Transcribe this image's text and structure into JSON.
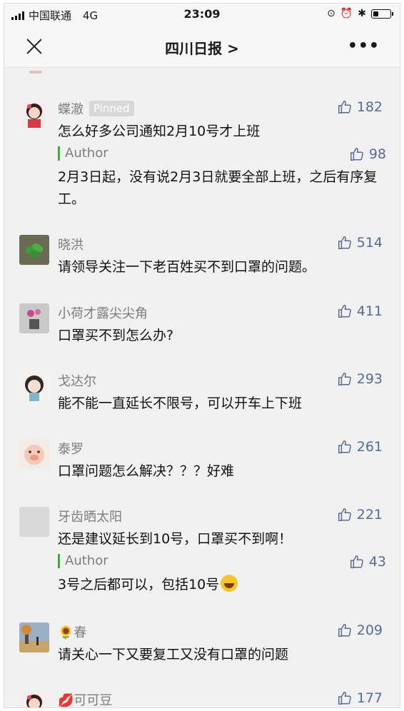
{
  "status_bar": {
    "carrier": "中国联通",
    "network": "4G",
    "time": "23:09",
    "battery_level": 0.3
  },
  "nav": {
    "title": "四川日报 >",
    "more": "•••"
  },
  "comments": [
    {
      "name": "蝶澈",
      "badge": "Pinned",
      "likes": "182",
      "text": "怎么好多公司通知2月10号才上班",
      "reply": {
        "author_label": "Author",
        "likes": "98",
        "text": "2月3日起，没有说2月3日就要全部上班，之后有序复工。"
      }
    },
    {
      "name": "晓洪",
      "likes": "514",
      "text": "请领导关注一下老百姓买不到口罩的问题。"
    },
    {
      "name": "小荷才露尖尖角",
      "likes": "411",
      "text": "口罩买不到怎么办?"
    },
    {
      "name": "戈达尔",
      "likes": "293",
      "text": "能不能一直延长不限号，可以开车上下班"
    },
    {
      "name": "泰罗",
      "likes": "261",
      "text": "口罩问题怎么解决？？？好难"
    },
    {
      "name": "牙齿晒太阳",
      "likes": "221",
      "text": "还是建议延长到10号，口罩买不到啊！",
      "reply": {
        "author_label": "Author",
        "likes": "43",
        "text": "3号之后都可以，包括10号"
      }
    },
    {
      "name": "🌻春",
      "likes": "209",
      "text": "请关心一下又要复工又没有口罩的问题"
    },
    {
      "name": "💋可可豆",
      "likes": "177",
      "text": ""
    }
  ],
  "icons": {
    "like": "thumbs-up-icon",
    "close": "close-icon",
    "more": "more-dots-icon"
  },
  "colors": {
    "like_blue": "#576b95",
    "author_green": "#3cb034",
    "name_gray": "#7d7d7d"
  }
}
